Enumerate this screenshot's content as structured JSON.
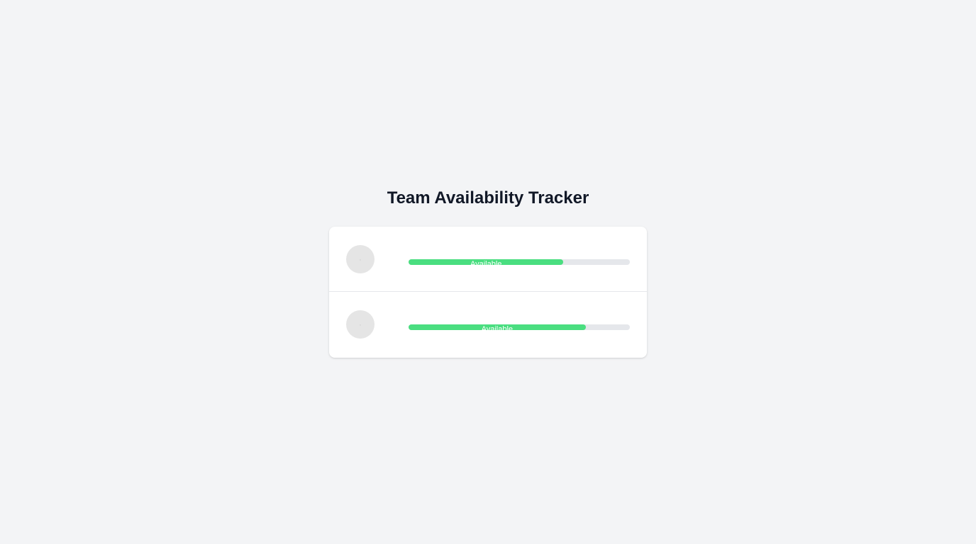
{
  "page": {
    "title": "Team Availability Tracker"
  },
  "members": [
    {
      "avatar_icon": "user-icon",
      "status": "Available",
      "availability_percent": 70
    },
    {
      "avatar_icon": "user-icon",
      "status": "Available",
      "availability_percent": 80
    }
  ],
  "colors": {
    "background": "#f3f4f6",
    "title": "#111827",
    "bar_track": "#e5e7eb",
    "bar_fill": "#4ade80"
  }
}
